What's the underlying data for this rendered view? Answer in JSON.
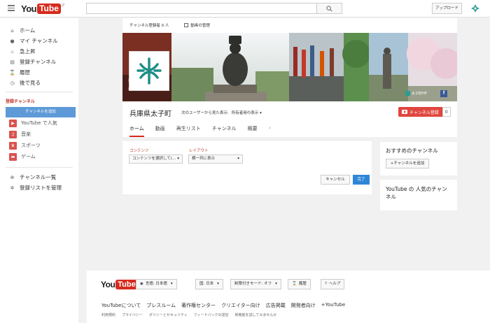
{
  "header": {
    "logo_you": "You",
    "logo_tube": "Tube",
    "logo_region": "JP",
    "search_placeholder": "",
    "upload_label": "アップロード"
  },
  "sidebar": {
    "nav": [
      {
        "label": "ホーム",
        "icon": "home-icon"
      },
      {
        "label": "マイ チャンネル",
        "icon": "person-icon"
      },
      {
        "label": "急上昇",
        "icon": "flame-icon"
      },
      {
        "label": "登録チャンネル",
        "icon": "subscriptions-icon"
      },
      {
        "label": "履歴",
        "icon": "hourglass-icon"
      },
      {
        "label": "後で見る",
        "icon": "clock-icon"
      }
    ],
    "section_title": "登録チャンネル",
    "add_channel_label": "チャンネルを追加",
    "subs": [
      {
        "label": "YouTube で人気",
        "icon": "youtube-icon"
      },
      {
        "label": "音楽",
        "icon": "headphones-icon"
      },
      {
        "label": "スポーツ",
        "icon": "trophy-icon"
      },
      {
        "label": "ゲーム",
        "icon": "gamepad-icon"
      }
    ],
    "bottom": [
      {
        "label": "チャンネル一覧",
        "icon": "plus-circle-icon"
      },
      {
        "label": "登録リストを管理",
        "icon": "gear-icon"
      }
    ]
  },
  "channel": {
    "subscriber_text": "チャンネル登録者 0 人",
    "video_manager": "動画の管理",
    "title": "兵庫県太子町",
    "view_as_label": "次のユーザーから見た表示:",
    "view_as_value": "所有者用の表示 ▾",
    "subscribe_label": "チャンネル登録",
    "subscribe_count": "0",
    "banner_link_text": "太子町HP",
    "tabs": [
      "ホーム",
      "動画",
      "再生リスト",
      "チャンネル",
      "概要"
    ],
    "active_tab": 0
  },
  "edit_panel": {
    "content_label": "コンテンツ",
    "content_value": "コンテンツを選択して(...",
    "layout_label": "レイアウト",
    "layout_value": "横一列に表示",
    "cancel_label": "キャンセル",
    "done_label": "完了"
  },
  "right": {
    "recommended_title": "おすすめのチャンネル",
    "add_channel_label": "+チャンネルを追加",
    "popular_title": "YouTube の 人気のチャンネル"
  },
  "footer": {
    "language_label": "言語: 日本語",
    "country_label": "国: 日本",
    "restricted_label": "制限付きモード: オフ",
    "history_label": "履歴",
    "help_label": "ヘルプ",
    "links": [
      "YouTubeについて",
      "プレスルーム",
      "著作権センター",
      "クリエイター向け",
      "広告掲載",
      "開発者向け",
      "+YouTube"
    ],
    "links2": [
      "利用規約",
      "プライバシー",
      "ポリシーとセキュリティ",
      "フィードバックの送信",
      "新機能を試してみませんか"
    ]
  },
  "colors": {
    "brand_red": "#d52b1e",
    "primary_blue": "#2f86d6",
    "sidebar_add_blue": "#5d9ad7",
    "logo_teal": "#1f8f86"
  }
}
